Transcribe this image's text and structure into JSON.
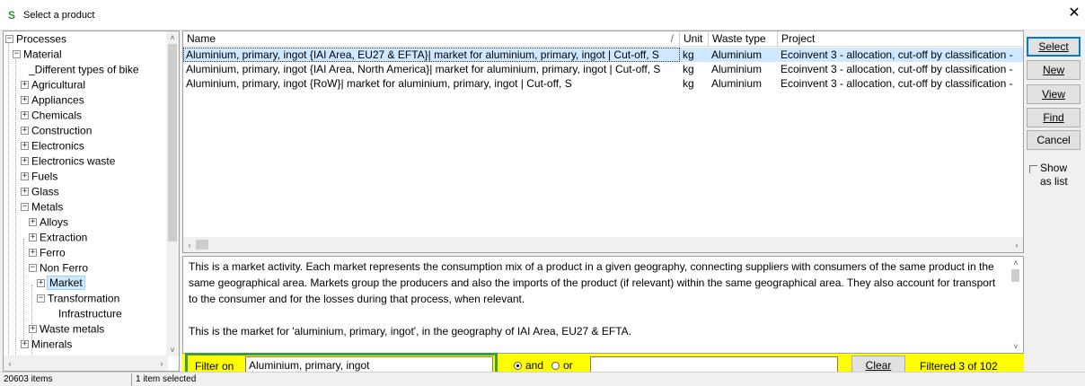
{
  "window": {
    "title": "Select a product",
    "close_glyph": "✕",
    "icon": "S"
  },
  "tree": {
    "items": [
      {
        "label": "Processes",
        "expander": "−"
      },
      {
        "label": "Material",
        "expander": "−"
      },
      {
        "label": "_Different types of bike",
        "expander": ""
      },
      {
        "label": "Agricultural",
        "expander": "+"
      },
      {
        "label": "Appliances",
        "expander": "+"
      },
      {
        "label": "Chemicals",
        "expander": "+"
      },
      {
        "label": "Construction",
        "expander": "+"
      },
      {
        "label": "Electronics",
        "expander": "+"
      },
      {
        "label": "Electronics waste",
        "expander": "+"
      },
      {
        "label": "Fuels",
        "expander": "+"
      },
      {
        "label": "Glass",
        "expander": "+"
      },
      {
        "label": "Metals",
        "expander": "−"
      },
      {
        "label": "Alloys",
        "expander": "+"
      },
      {
        "label": "Extraction",
        "expander": "+"
      },
      {
        "label": "Ferro",
        "expander": "+"
      },
      {
        "label": "Non Ferro",
        "expander": "−"
      },
      {
        "label": "Market",
        "expander": "+"
      },
      {
        "label": "Transformation",
        "expander": "−"
      },
      {
        "label": "Infrastructure",
        "expander": ""
      },
      {
        "label": "Waste metals",
        "expander": "+"
      },
      {
        "label": "Minerals",
        "expander": "+"
      }
    ]
  },
  "grid": {
    "columns": [
      "Name",
      "Unit",
      "Waste type",
      "Project"
    ],
    "sort_glyph": "/",
    "rows": [
      {
        "name": "Aluminium, primary, ingot {IAI Area, EU27 & EFTA}| market for aluminium, primary, ingot | Cut-off, S",
        "unit": "kg",
        "waste": "Aluminium",
        "project": "Ecoinvent 3 - allocation, cut-off by classification -"
      },
      {
        "name": "Aluminium, primary, ingot {IAI Area, North America}| market for aluminium, primary, ingot | Cut-off, S",
        "unit": "kg",
        "waste": "Aluminium",
        "project": "Ecoinvent 3 - allocation, cut-off by classification -"
      },
      {
        "name": "Aluminium, primary, ingot {RoW}| market for aluminium, primary, ingot | Cut-off, S",
        "unit": "kg",
        "waste": "Aluminium",
        "project": "Ecoinvent 3 - allocation, cut-off by classification -"
      }
    ]
  },
  "description": {
    "para1": "This is a market activity. Each market represents the consumption mix of a product in a given geography, connecting suppliers with consumers of the same product in the same geographical area. Markets group the producers and also the imports of the product (if relevant) within the same geographical area. They also account for transport to the consumer and for the losses during that process, when relevant.",
    "para2": "This is the market for  'aluminium, primary, ingot', in the geography of IAI Area, EU27 & EFTA."
  },
  "filter": {
    "label": "Filter on",
    "value": "Aluminium, primary, ingot",
    "and_label": "and",
    "or_label": "or",
    "second_value": "",
    "clear_label": "Clear",
    "status": "Filtered 3 of 102"
  },
  "buttons": {
    "select": "Select",
    "new": "New",
    "view": "View",
    "find": "Find",
    "cancel": "Cancel"
  },
  "show_as_list": "Show as list",
  "statusbar": {
    "items": "20603 items",
    "selected": "1 item selected"
  },
  "colors": {
    "filter_bar": "#ffff00",
    "highlight_outline": "#3a9c3a",
    "selection": "#cde8ff"
  }
}
